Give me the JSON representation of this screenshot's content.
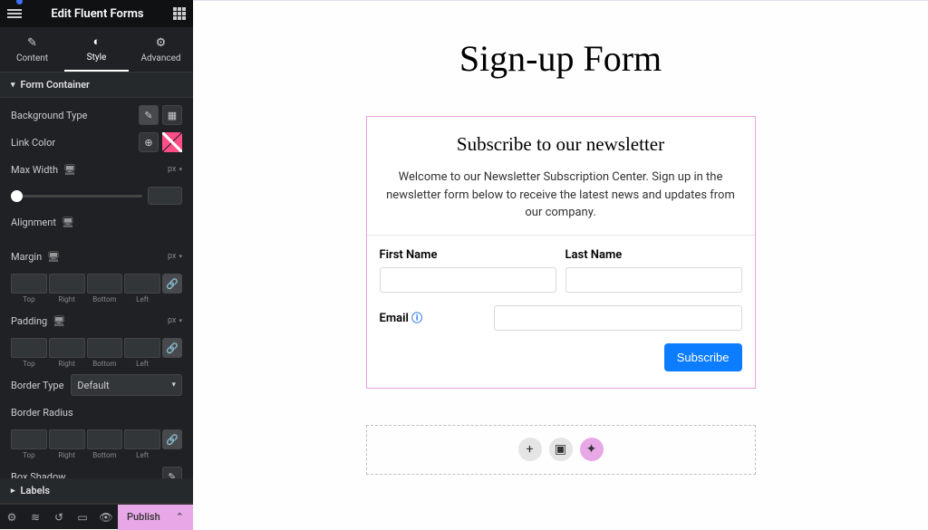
{
  "header": {
    "title": "Edit Fluent Forms"
  },
  "tabs": {
    "content": "Content",
    "style": "Style",
    "advanced": "Advanced"
  },
  "sections": {
    "form_container": "Form Container",
    "labels": "Labels"
  },
  "labels": {
    "background_type": "Background Type",
    "link_color": "Link Color",
    "max_width": "Max Width",
    "alignment": "Alignment",
    "margin": "Margin",
    "padding": "Padding",
    "border_type": "Border Type",
    "border_radius": "Border Radius",
    "box_shadow": "Box Shadow"
  },
  "dims": {
    "top": "Top",
    "right": "Right",
    "bottom": "Bottom",
    "left": "Left"
  },
  "units": {
    "px": "px"
  },
  "select": {
    "default": "Default"
  },
  "footer": {
    "publish": "Publish"
  },
  "preview": {
    "title": "Sign-up Form",
    "form_title": "Subscribe to our newsletter",
    "form_desc": "Welcome to our Newsletter Subscription Center. Sign up in the newsletter form below to receive the latest news and updates from our company.",
    "first_name": "First Name",
    "last_name": "Last Name",
    "email": "Email",
    "submit": "Subscribe"
  }
}
